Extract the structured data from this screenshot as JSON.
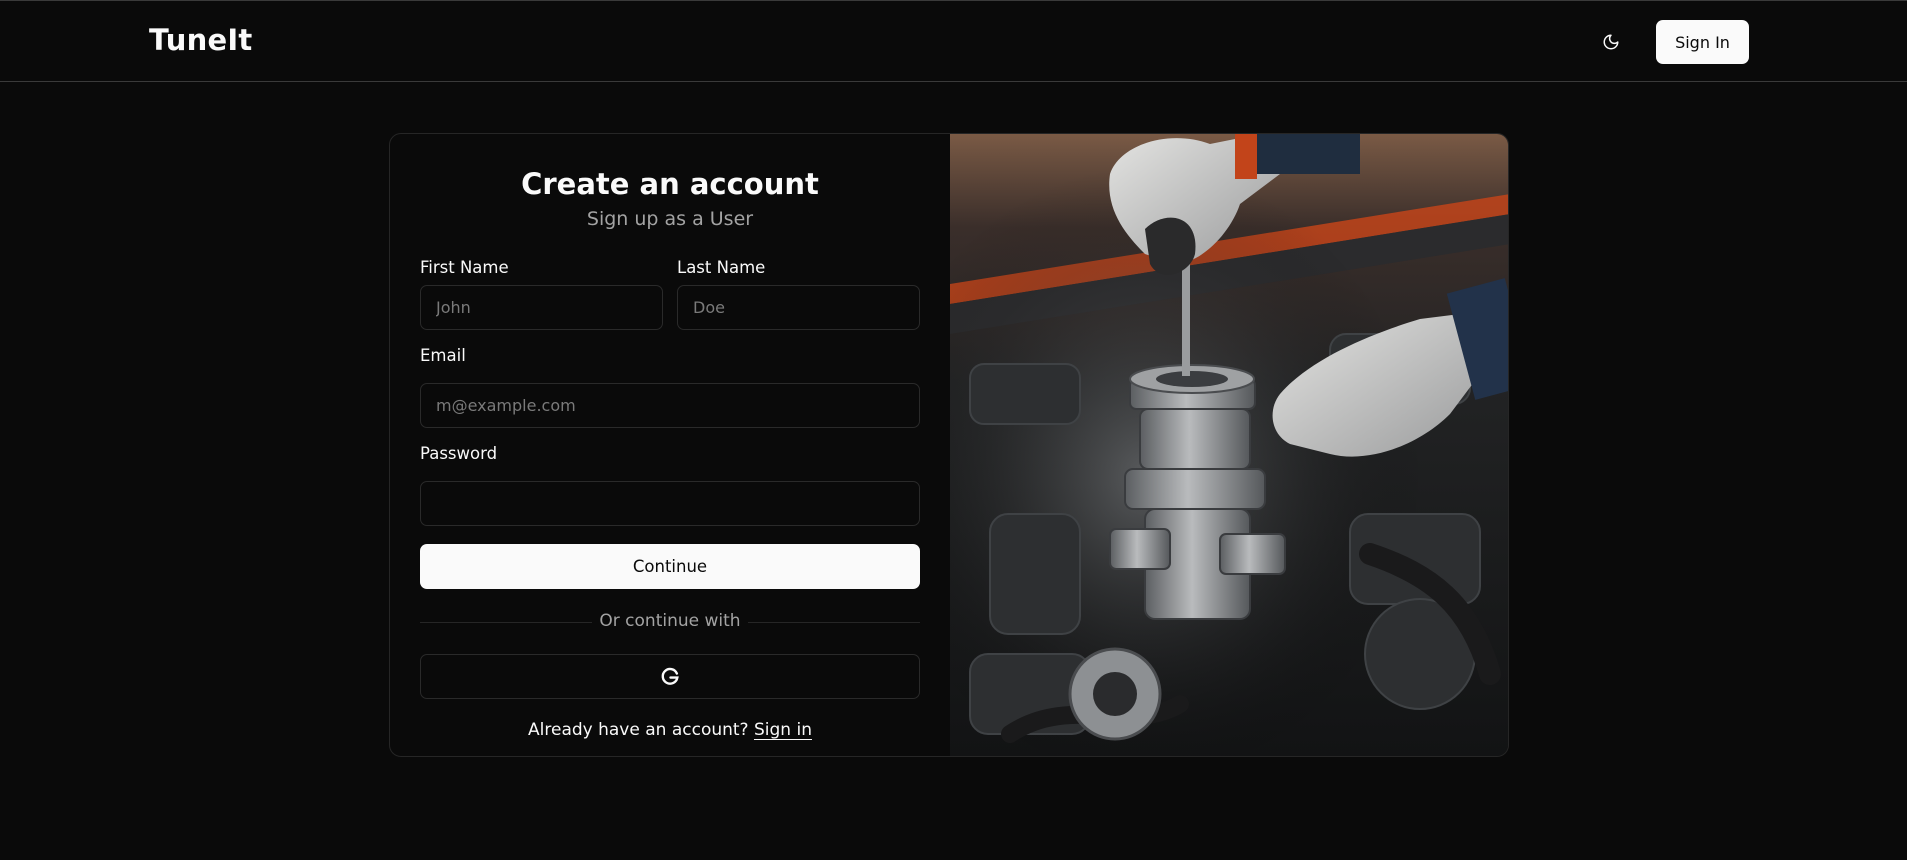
{
  "header": {
    "brand": "TuneIt",
    "theme_toggle_icon": "moon-icon",
    "signin_label": "Sign In"
  },
  "signup": {
    "title": "Create an account",
    "subtitle": "Sign up as a User",
    "first_name": {
      "label": "First Name",
      "placeholder": "John",
      "value": ""
    },
    "last_name": {
      "label": "Last Name",
      "placeholder": "Doe",
      "value": ""
    },
    "email": {
      "label": "Email",
      "placeholder": "m@example.com",
      "value": ""
    },
    "password": {
      "label": "Password",
      "placeholder": "",
      "value": ""
    },
    "continue_label": "Continue",
    "divider_text": "Or continue with",
    "google_icon": "google-icon",
    "footer_prefix": "Already have an account?",
    "footer_link": "Sign in"
  },
  "hero_image": {
    "subject": "gloved hands working on car engine"
  },
  "colors": {
    "background": "#0a0a0a",
    "foreground": "#fafafa",
    "muted": "#a3a3a3",
    "border": "#262626"
  }
}
